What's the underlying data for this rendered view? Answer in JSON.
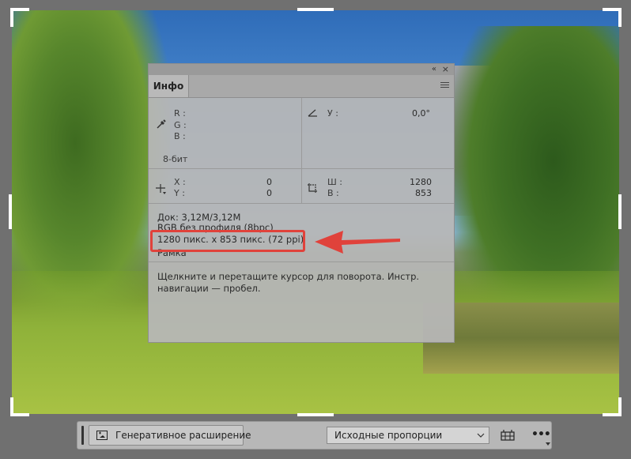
{
  "info_panel": {
    "tab_title": "Инфо",
    "collapse_label": "«",
    "close_label": "×",
    "rgb": {
      "r_label": "R :",
      "g_label": "G :",
      "b_label": "B :"
    },
    "bit_depth": "8-бит",
    "angle": {
      "label": "У :",
      "value": "0,0°"
    },
    "coords": {
      "x_label": "X :",
      "y_label": "Y :",
      "x_value": "0",
      "y_value": "0"
    },
    "size": {
      "w_label": "Ш :",
      "h_label": "В :",
      "w_value": "1280",
      "h_value": "853"
    },
    "doc_line": "Док: 3,12M/3,12M",
    "profile_line": "RGB без профиля (8bpc)",
    "dimensions_line": "1280 пикс. x 853 пикс. (72 ppi)",
    "tool_line": "Рамка",
    "hint": "Щелкните и перетащите курсор для поворота. Инстр. навигации — пробел."
  },
  "annotation": {
    "color": "#e0423b"
  },
  "context_bar": {
    "generative_button_label": "Генеративное расширение",
    "aspect_select_value": "Исходные пропорции",
    "more_label": "•••"
  }
}
